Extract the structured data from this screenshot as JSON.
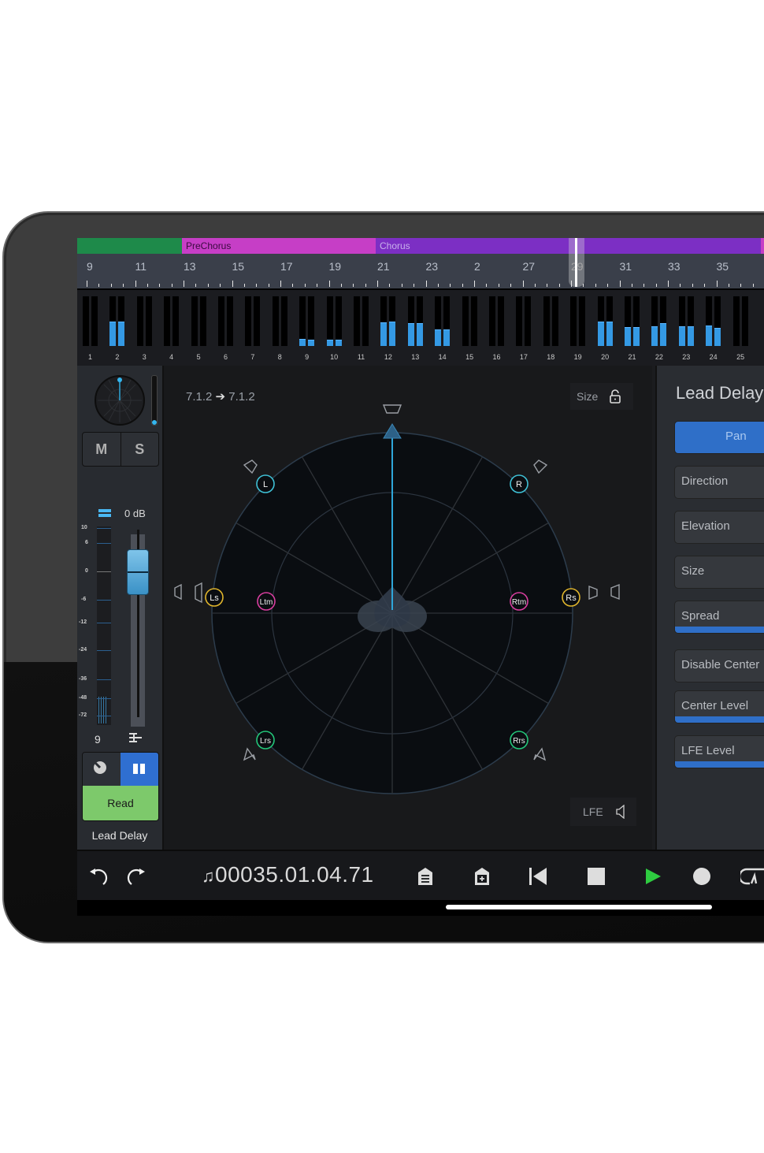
{
  "arranger": {
    "sections": [
      {
        "label": "",
        "color": "#1e8a4a"
      },
      {
        "label": "PreChorus",
        "color": "#c63ec6"
      },
      {
        "label": "Chorus",
        "color": "#7c2fc4"
      },
      {
        "label": "",
        "color": "#c63ec6"
      }
    ],
    "ruler_numbers": [
      "9",
      "11",
      "13",
      "15",
      "17",
      "19",
      "21",
      "23",
      "2",
      "27",
      "29",
      "31",
      "33",
      "35"
    ],
    "playhead_bar": "29"
  },
  "meters": {
    "channels": [
      {
        "num": "1",
        "l": 0,
        "r": 0
      },
      {
        "num": "2",
        "l": 0.5,
        "r": 0.5
      },
      {
        "num": "3",
        "l": 0,
        "r": 0
      },
      {
        "num": "4",
        "l": 0,
        "r": 0
      },
      {
        "num": "5",
        "l": 0,
        "r": 0
      },
      {
        "num": "6",
        "l": 0,
        "r": 0
      },
      {
        "num": "7",
        "l": 0,
        "r": 0
      },
      {
        "num": "8",
        "l": 0,
        "r": 0
      },
      {
        "num": "9",
        "l": 0.14,
        "r": 0.12
      },
      {
        "num": "10",
        "l": 0.12,
        "r": 0.12
      },
      {
        "num": "11",
        "l": 0,
        "r": 0
      },
      {
        "num": "12",
        "l": 0.47,
        "r": 0.49
      },
      {
        "num": "13",
        "l": 0.46,
        "r": 0.46
      },
      {
        "num": "14",
        "l": 0.33,
        "r": 0.33
      },
      {
        "num": "15",
        "l": 0,
        "r": 0
      },
      {
        "num": "16",
        "l": 0,
        "r": 0
      },
      {
        "num": "17",
        "l": 0,
        "r": 0
      },
      {
        "num": "18",
        "l": 0,
        "r": 0
      },
      {
        "num": "19",
        "l": 0,
        "r": 0
      },
      {
        "num": "20",
        "l": 0.5,
        "r": 0.5
      },
      {
        "num": "21",
        "l": 0.38,
        "r": 0.38
      },
      {
        "num": "22",
        "l": 0.4,
        "r": 0.46
      },
      {
        "num": "23",
        "l": 0.4,
        "r": 0.4
      },
      {
        "num": "24",
        "l": 0.42,
        "r": 0.36
      },
      {
        "num": "25",
        "l": 0,
        "r": 0
      }
    ]
  },
  "strip": {
    "mute_label": "M",
    "solo_label": "S",
    "volume_label": "0 dB",
    "volume_db": 0,
    "scale_labels": [
      "10",
      "6",
      "0",
      "-6",
      "-12",
      "-24",
      "-36",
      "-48",
      "-72"
    ],
    "channel_number": "9",
    "automation_mode": "Read",
    "name": "Lead Delay"
  },
  "panner": {
    "format_in": "7.1.2",
    "format_out": "7.1.2",
    "arrow": "➔",
    "size_label": "Size",
    "lfe_label": "LFE",
    "lfe_slider_level": 0.0,
    "speakers": [
      {
        "id": "L",
        "color": "#3fc1d6"
      },
      {
        "id": "R",
        "color": "#3fc1d6"
      },
      {
        "id": "Ls",
        "color": "#e0b52c"
      },
      {
        "id": "Rs",
        "color": "#e0b52c"
      },
      {
        "id": "Ltm",
        "color": "#d93ea0"
      },
      {
        "id": "Rtm",
        "color": "#d93ea0"
      },
      {
        "id": "Lrs",
        "color": "#23c77a"
      },
      {
        "id": "Rrs",
        "color": "#23c77a"
      }
    ]
  },
  "right_panel": {
    "title": "Lead Delay",
    "buttons": [
      {
        "label": "Pan",
        "active": true
      },
      {
        "label": "Direction",
        "level": null
      },
      {
        "label": "Elevation",
        "level": null
      },
      {
        "label": "Size",
        "level": null
      },
      {
        "label": "Spread",
        "level": 1.0
      },
      {
        "label": "Disable Center",
        "level": null
      },
      {
        "label": "Center Level",
        "level": 1.0
      },
      {
        "label": "LFE Level",
        "level": 1.0
      }
    ]
  },
  "transport": {
    "time": "00035.01.04.71",
    "icons": [
      "undo-icon",
      "redo-icon",
      "music-note-icon",
      "marker-list-icon",
      "add-marker-icon",
      "return-to-start-icon",
      "stop-icon",
      "play-icon",
      "record-icon",
      "loop-icon"
    ],
    "play_color": "#2ecc40"
  }
}
